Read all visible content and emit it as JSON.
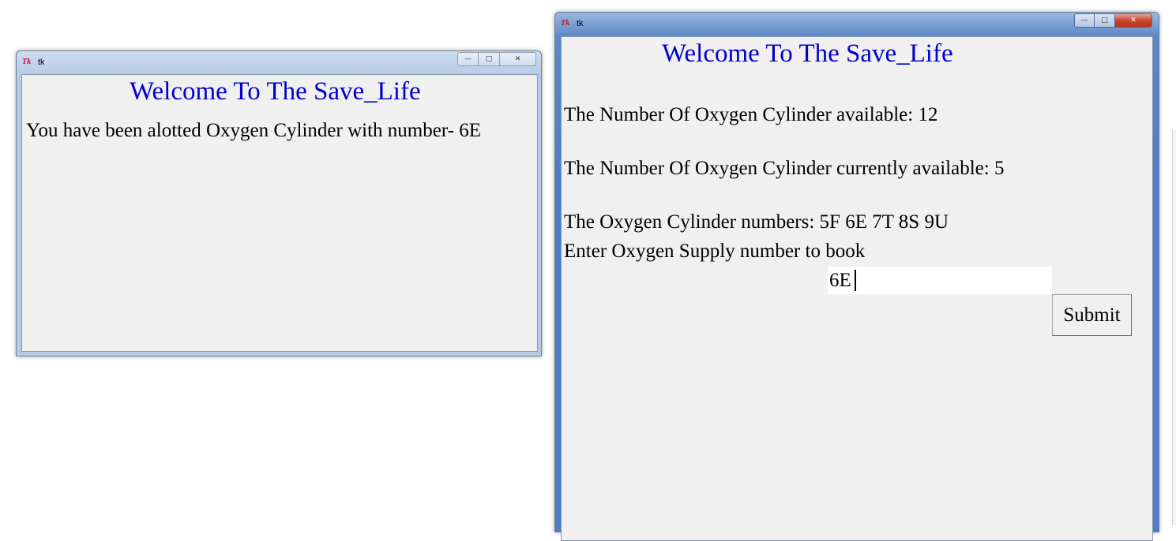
{
  "left_window": {
    "title": "tk",
    "icon": "tk-feather-icon",
    "icon_glyph": "Tk",
    "controls": {
      "minimize": "—",
      "maximize": "□",
      "close": "✕"
    },
    "heading": "Welcome To The Save_Life",
    "message": "You have been alotted Oxygen Cylinder with number- 6E"
  },
  "right_window": {
    "title": "tk",
    "icon": "tk-feather-icon",
    "icon_glyph": "Tk",
    "controls": {
      "minimize": "—",
      "maximize": "□",
      "close": "✕"
    },
    "heading": "Welcome To The Save_Life",
    "total_available": "The Number  Of Oxygen Cylinder available:  12",
    "currently_available": "The Number  Of Oxygen Cylinder currently available:  5",
    "cylinder_numbers": "The  Oxygen Cylinder numbers: 5F 6E 7T 8S 9U",
    "prompt": "Enter Oxygen Supply number to book",
    "entry_value": "6E",
    "submit_label": "Submit"
  },
  "colors": {
    "heading": "#0000cc",
    "client_bg": "#f0f0f0",
    "active_frame": "#4e7ec3",
    "inactive_frame": "#b7cbe6",
    "close_button_active": "#c9452b"
  }
}
